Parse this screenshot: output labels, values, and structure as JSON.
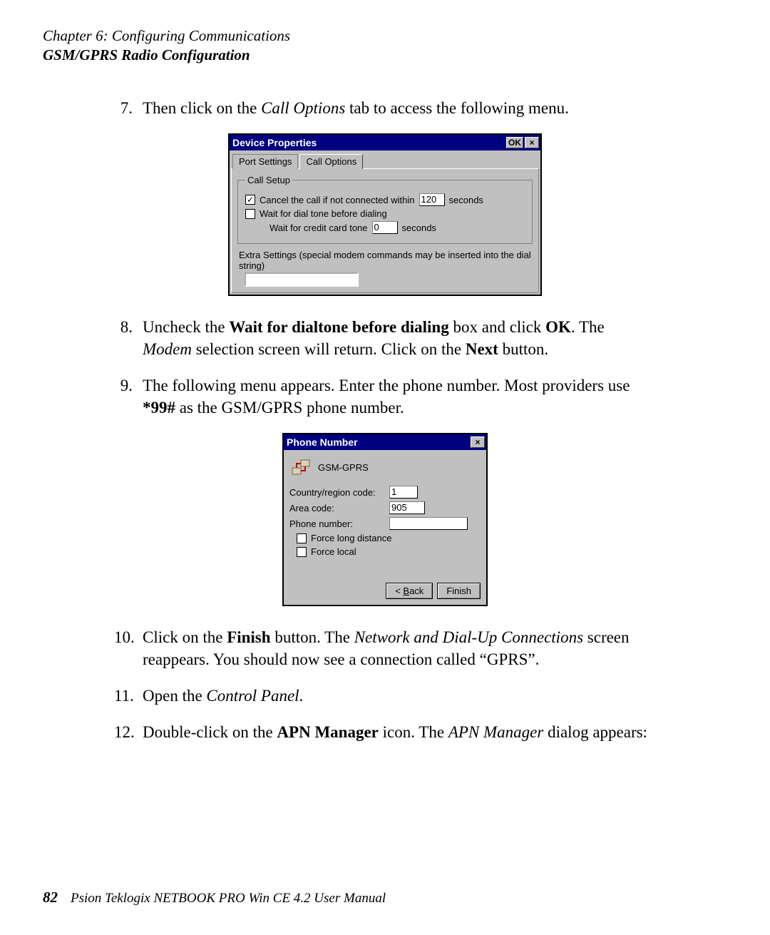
{
  "header": {
    "chapter": "Chapter 6:  Configuring Communications",
    "section": "GSM/GPRS Radio Configuration"
  },
  "steps": {
    "s7": {
      "num": "7.",
      "p1a": "Then click on the ",
      "callOptions": "Call Options",
      "p1b": " tab to access the following menu."
    },
    "s8": {
      "num": "8.",
      "p1a": "Uncheck the ",
      "b1": "Wait for dialtone before dialing",
      "p1b": " box and click ",
      "b2": "OK",
      "p1c": ". The ",
      "modem": "Modem",
      "p1d": " selection screen will return. Click on the ",
      "next": "Next",
      "p1e": " button."
    },
    "s9": {
      "num": "9.",
      "p1a": "The following menu appears. Enter the phone number. Most providers use ",
      "b1": "*99#",
      "p1b": " as the GSM/GPRS phone number."
    },
    "s10": {
      "num": "10.",
      "p1a": "Click on the ",
      "finish": "Finish",
      "p1b": " button. The ",
      "ndu": "Network and Dial-Up Connections",
      "p1c": " screen reappears. You should now see a connection called “GPRS”."
    },
    "s11": {
      "num": "11.",
      "p1a": "Open the ",
      "cp": "Control Panel",
      "p1b": "."
    },
    "s12": {
      "num": "12.",
      "p1a": "Double-click on the ",
      "apn": "APN Manager",
      "p1b": " icon. The ",
      "apnmgr": "APN Manager",
      "p1c": " dialog appears:"
    }
  },
  "dialog1": {
    "title": "Device Properties",
    "ok": "OK",
    "close": "×",
    "tabs": {
      "port": "Port Settings",
      "call": "Call Options"
    },
    "group": "Call Setup",
    "cancelCall": "Cancel the call if not connected within",
    "cancelVal": "120",
    "seconds": "seconds",
    "waitDial": "Wait for dial tone before dialing",
    "waitCredit": "Wait for credit card tone",
    "creditVal": "0",
    "extra": "Extra Settings (special modem commands may be inserted into the dial string)"
  },
  "dialog2": {
    "title": "Phone Number",
    "close": "×",
    "connName": "GSM-GPRS",
    "country": "Country/region code:",
    "countryVal": "1",
    "area": "Area code:",
    "areaVal": "905",
    "phone": "Phone number:",
    "phoneVal": "",
    "forceLD": "Force long distance",
    "forceLocal": "Force local",
    "back": "< Back",
    "finish": "Finish"
  },
  "footer": {
    "page": "82",
    "title": "Psion Teklogix NETBOOK PRO Win CE 4.2 User Manual"
  }
}
